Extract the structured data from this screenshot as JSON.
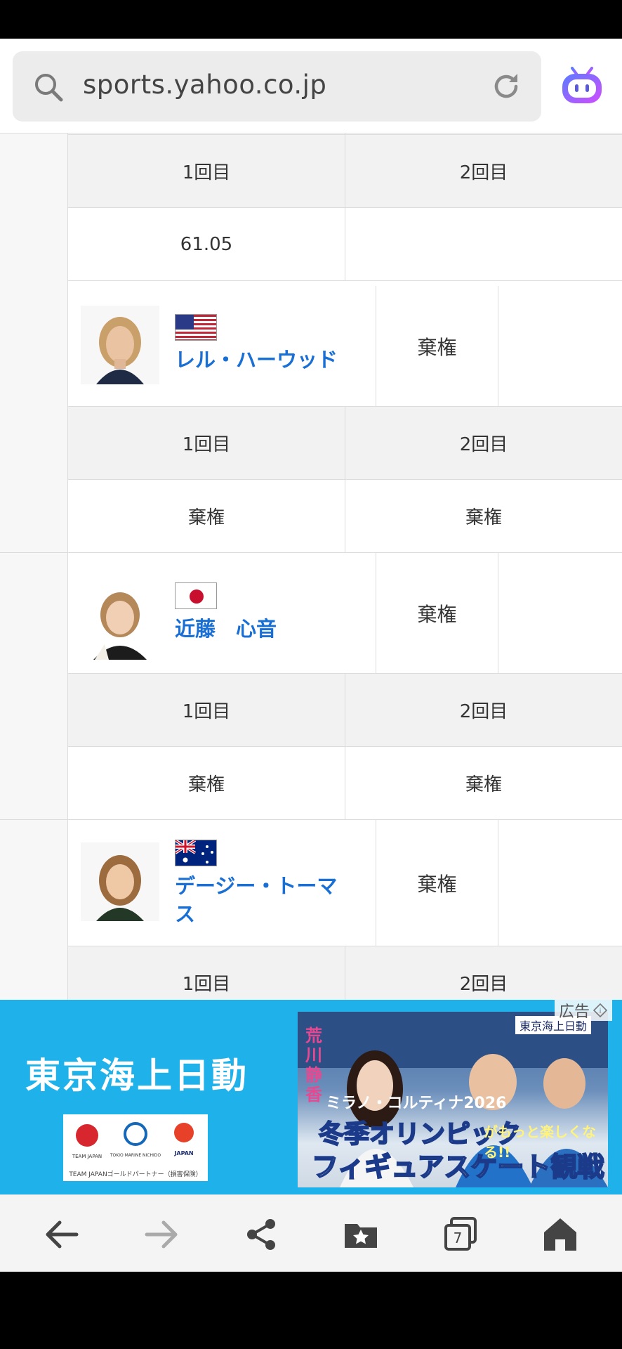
{
  "browser": {
    "url": "sports.yahoo.co.jp",
    "tab_count": "7"
  },
  "results": {
    "round1_label": "1回目",
    "round2_label": "2回目",
    "top_block": {
      "round1_value": "61.05",
      "round2_value": ""
    },
    "players": [
      {
        "name": "レル・ハーウッド",
        "country_flag": "usa",
        "status": "棄権",
        "round1": "棄権",
        "round2": "棄権"
      },
      {
        "name": "近藤　心音",
        "country_flag": "japan",
        "status": "棄権",
        "round1": "棄権",
        "round2": "棄権"
      },
      {
        "name": "デージー・トーマス",
        "country_flag": "australia",
        "status": "棄権"
      }
    ]
  },
  "ad": {
    "label": "広告",
    "brand": "東京海上日動",
    "logo_caption": "TEAM JAPANゴールドパートナー（損害保険）",
    "logo1": "TEAM JAPAN",
    "logo2": "TOKIO MARINE NICHIDO",
    "logo3": "JAPAN",
    "person": "荒川静香",
    "subtitle": "ミラノ・コルティナ2026",
    "headline1": "冬季オリンピック",
    "headline_tail": "がもっと楽しくなる!!",
    "headline2": "フィギュアスケート観戦術",
    "corner_brand": "東京海上日動"
  },
  "nav": {
    "icons": [
      "back-icon",
      "forward-icon",
      "share-icon",
      "bookmarks-icon",
      "tabs-icon",
      "home-icon"
    ]
  }
}
